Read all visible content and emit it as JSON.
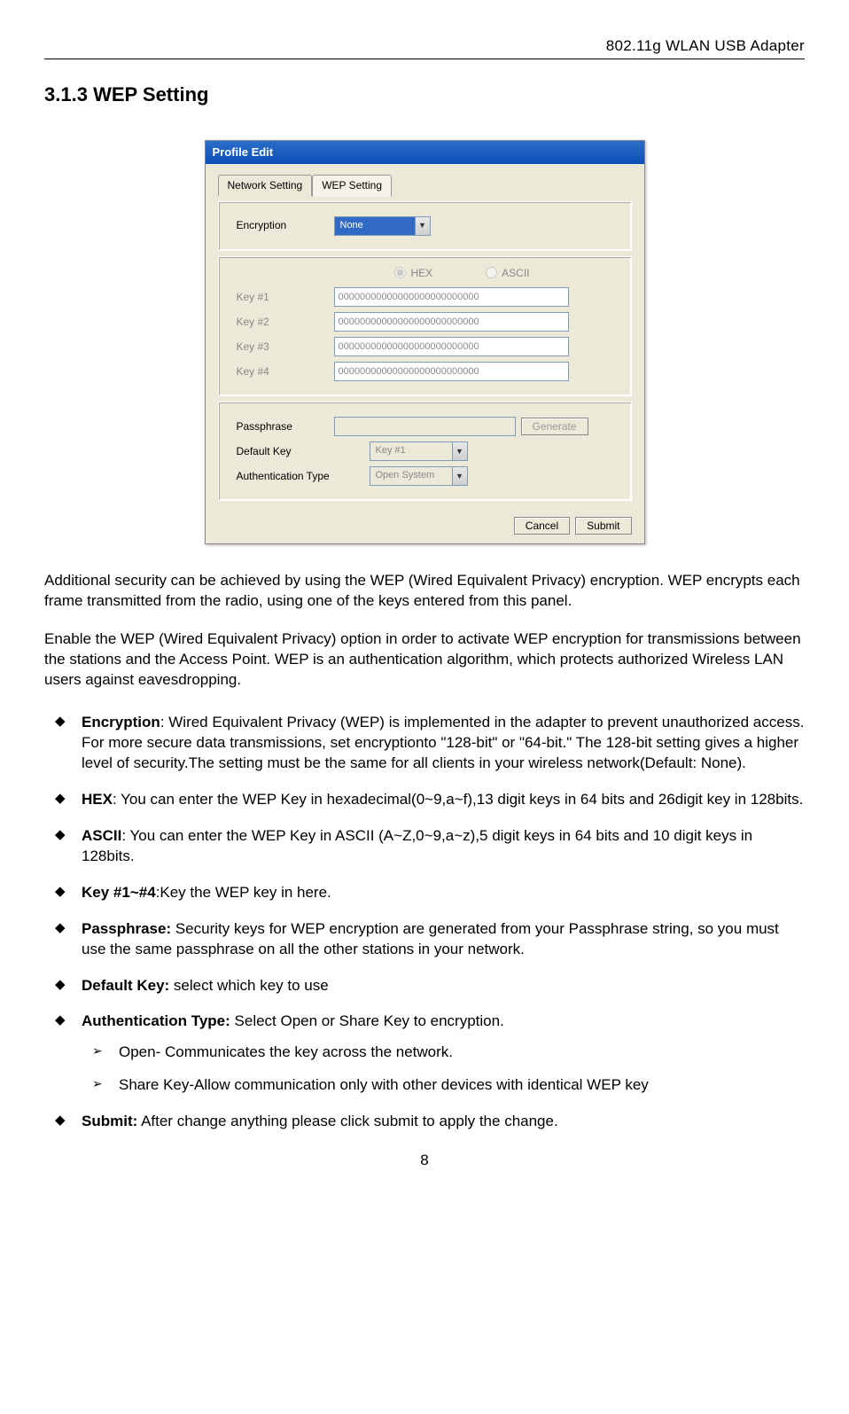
{
  "header": {
    "product": "802.11g WLAN USB Adapter"
  },
  "section": {
    "number": "3.1.3",
    "title": "WEP Setting"
  },
  "dialog": {
    "title": "Profile Edit",
    "tabs": {
      "network": "Network Setting",
      "wep": "WEP Setting"
    },
    "encryption": {
      "label": "Encryption",
      "value": "None"
    },
    "format": {
      "hex": "HEX",
      "ascii": "ASCII"
    },
    "keys": {
      "k1label": "Key #1",
      "k1value": "00000000000000000000000000",
      "k2label": "Key #2",
      "k2value": "00000000000000000000000000",
      "k3label": "Key #3",
      "k3value": "00000000000000000000000000",
      "k4label": "Key #4",
      "k4value": "00000000000000000000000000"
    },
    "passphrase": {
      "label": "Passphrase",
      "value": "",
      "generate": "Generate"
    },
    "defaultkey": {
      "label": "Default Key",
      "value": "Key #1"
    },
    "authtype": {
      "label": "Authentication Type",
      "value": "Open System"
    },
    "buttons": {
      "cancel": "Cancel",
      "submit": "Submit"
    }
  },
  "paragraphs": {
    "p1": "Additional security can be achieved by using the WEP (Wired Equivalent Privacy) encryption. WEP encrypts each frame transmitted from the radio, using one of the keys entered from this panel.",
    "p2": "Enable the WEP (Wired Equivalent Privacy) option in order to activate WEP encryption for transmissions between the stations and the Access Point. WEP is an authentication algorithm, which protects authorized Wireless LAN users against eavesdropping."
  },
  "bullets": {
    "encryption_label": "Encryption",
    "encryption_text": ": Wired Equivalent Privacy (WEP) is implemented in the adapter to prevent unauthorized access. For more secure data transmissions, set encryptionto \"128-bit\" or \"64-bit.\" The 128-bit setting gives a higher level of security.The setting must be the same for all clients in your wireless network(Default: None).",
    "hex_label": "HEX",
    "hex_text": ": You can enter the WEP Key in hexadecimal(0~9,a~f),13 digit keys in 64 bits and 26digit key in 128bits.",
    "ascii_label": "ASCII",
    "ascii_text": ": You can enter the WEP Key in ASCII (A~Z,0~9,a~z),5 digit keys in 64 bits and 10 digit keys in 128bits.",
    "key_label": "Key #1~#4",
    "key_text": ":Key the WEP key in here.",
    "passphrase_label": "Passphrase:",
    "passphrase_text": " Security keys for WEP encryption are generated from your Passphrase string, so you must use the same passphrase on all the other stations in your network.",
    "defaultkey_label": "Default Key:",
    "defaultkey_text": " select which key to use",
    "authtype_label": "Authentication Type:",
    "authtype_text": " Select Open or Share Key to encryption.",
    "sub_open": "Open- Communicates the key across the network.",
    "sub_share": "Share Key-Allow communication only with other devices with identical WEP key",
    "submit_label": "Submit:",
    "submit_text": " After change anything please click submit to apply the change."
  },
  "page_number": "8"
}
